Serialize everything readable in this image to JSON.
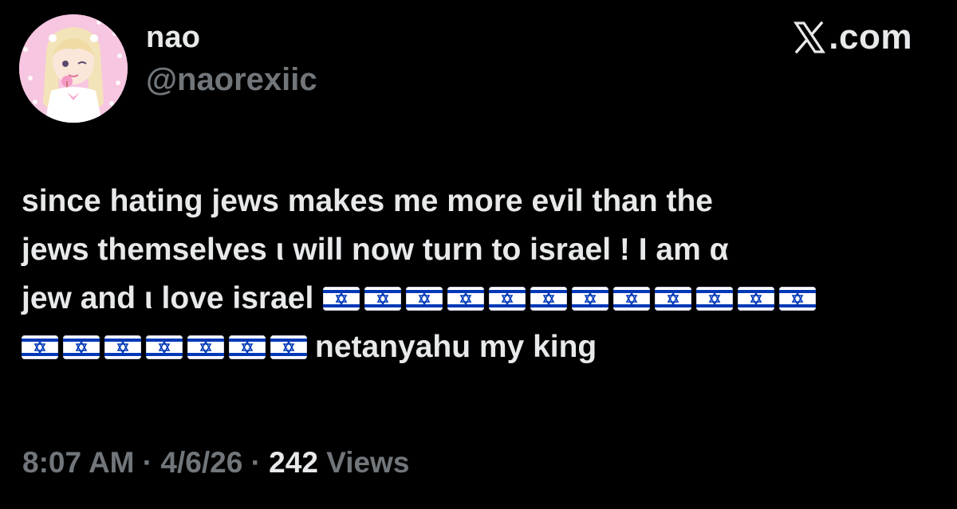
{
  "author": {
    "display_name": "nao",
    "handle": "@naorexiic"
  },
  "brand": {
    "logo_icon": "x-logo-icon",
    "domain": ".com"
  },
  "tweet": {
    "line1": "since hating jews makes me more evil than the",
    "line2": "jews themselves ι will now turn to israel ! I am α",
    "line3_text": "jew and ι love israel",
    "line3_flag_count": 12,
    "line4_flag_count": 7,
    "line4_text": "netanyahu my king",
    "flag_emoji": "🇮🇱"
  },
  "meta": {
    "time": "8:07 AM",
    "separator": "·",
    "date": "4/6/26",
    "views_count": "242",
    "views_label": "Views"
  },
  "colors": {
    "background": "#000000",
    "primary_text": "#e7e9ea",
    "secondary_text": "#71767b",
    "flag_blue": "#0038b8"
  }
}
